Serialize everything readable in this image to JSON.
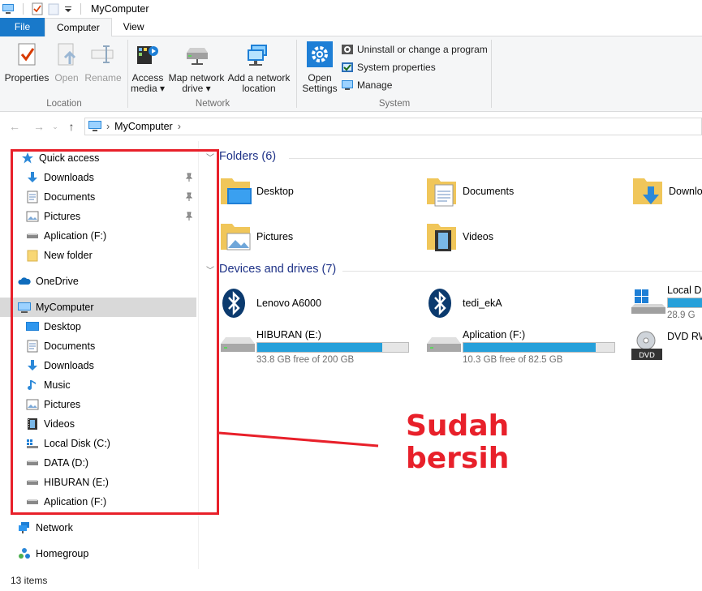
{
  "window": {
    "title": "MyComputer"
  },
  "tabs": [
    {
      "label": "File"
    },
    {
      "label": "Computer"
    },
    {
      "label": "View"
    }
  ],
  "ribbon": {
    "location": {
      "label": "Location",
      "properties": "Properties",
      "open": "Open",
      "rename": "Rename"
    },
    "network": {
      "label": "Network",
      "access_media": [
        "Access",
        "media ▾"
      ],
      "map_drive": [
        "Map network",
        "drive ▾"
      ],
      "add_location": [
        "Add a network",
        "location"
      ]
    },
    "system": {
      "label": "System",
      "open_settings": [
        "Open",
        "Settings"
      ],
      "uninstall": "Uninstall or change a program",
      "sys_props": "System properties",
      "manage": "Manage"
    }
  },
  "address": {
    "crumb": "MyComputer",
    "sep": "›"
  },
  "nav_pane": {
    "quick_access": "Quick access",
    "qa_items": [
      "Downloads",
      "Documents",
      "Pictures",
      "Aplication (F:)",
      "New folder"
    ],
    "onedrive": "OneDrive",
    "mycomputer": "MyComputer",
    "pc_items": [
      "Desktop",
      "Documents",
      "Downloads",
      "Music",
      "Pictures",
      "Videos",
      "Local Disk (C:)",
      "DATA (D:)",
      "HIBURAN (E:)",
      "Aplication (F:)"
    ],
    "network": "Network",
    "homegroup": "Homegroup"
  },
  "content": {
    "folders_header": "Folders (6)",
    "folders": [
      "Desktop",
      "Documents",
      "Downloads",
      "Pictures",
      "Videos"
    ],
    "drives_header": "Devices and drives (7)",
    "devices": [
      "Lenovo A6000",
      "tedi_ekA"
    ],
    "drives": [
      {
        "name": "Local D",
        "free": "28.9 G",
        "used_fraction": 0.9
      },
      {
        "name": "HIBURAN (E:)",
        "free": "33.8 GB free of 200 GB",
        "used_fraction": 0.83
      },
      {
        "name": "Aplication (F:)",
        "free": "10.3 GB free of 82.5 GB",
        "used_fraction": 0.875
      },
      {
        "name": "DVD RW"
      }
    ]
  },
  "status": {
    "items": "13 items"
  },
  "annotation": {
    "line1": "Sudah",
    "line2": "bersih"
  },
  "colors": {
    "accent": "#1979ca",
    "annotation": "#e8202a",
    "bar_fill": "#26a0da",
    "folder": "#f0c65a"
  }
}
